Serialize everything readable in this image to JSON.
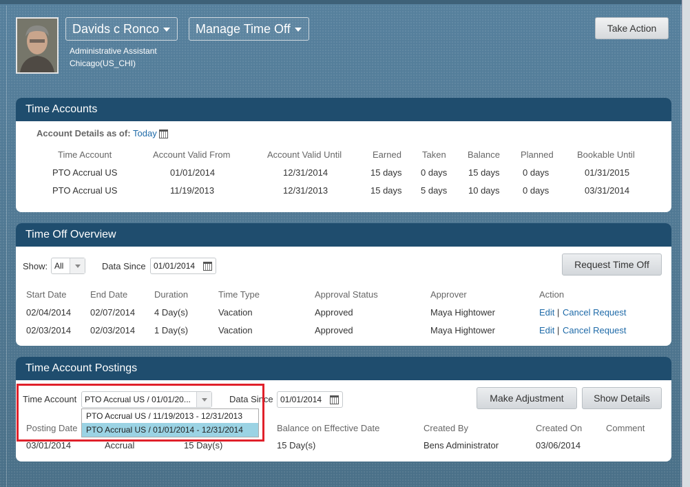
{
  "header": {
    "employee_name": "Davids c Ronco",
    "menu_label": "Manage Time Off",
    "job_title": "Administrative Assistant",
    "location": "Chicago(US_CHI)",
    "take_action": "Take Action"
  },
  "time_accounts": {
    "title": "Time Accounts",
    "details_label": "Account Details as of:",
    "details_value": "Today",
    "columns": [
      "Time Account",
      "Account Valid From",
      "Account Valid Until",
      "Earned",
      "Taken",
      "Balance",
      "Planned",
      "Bookable Until"
    ],
    "rows": [
      [
        "PTO Accrual US",
        "01/01/2014",
        "12/31/2014",
        "15 days",
        "0 days",
        "15 days",
        "0 days",
        "01/31/2015"
      ],
      [
        "PTO Accrual US",
        "11/19/2013",
        "12/31/2013",
        "15 days",
        "5 days",
        "10 days",
        "0 days",
        "03/31/2014"
      ]
    ]
  },
  "time_off_overview": {
    "title": "Time Off Overview",
    "show_label": "Show:",
    "show_value": "All",
    "data_since_label": "Data Since",
    "data_since_value": "01/01/2014",
    "request_button": "Request Time Off",
    "columns": [
      "Start Date",
      "End Date",
      "Duration",
      "Time Type",
      "Approval Status",
      "Approver",
      "Action"
    ],
    "rows": [
      {
        "start": "02/04/2014",
        "end": "02/07/2014",
        "duration": "4 Day(s)",
        "type": "Vacation",
        "status": "Approved",
        "approver": "Maya Hightower",
        "edit": "Edit",
        "sep": "|",
        "cancel": "Cancel Request"
      },
      {
        "start": "02/03/2014",
        "end": "02/03/2014",
        "duration": "1 Day(s)",
        "type": "Vacation",
        "status": "Approved",
        "approver": "Maya Hightower",
        "edit": "Edit",
        "sep": "|",
        "cancel": "Cancel Request"
      }
    ]
  },
  "postings": {
    "title": "Time Account Postings",
    "account_label": "Time Account",
    "account_value": "PTO Accrual US / 01/01/20...",
    "data_since_label": "Data Since",
    "data_since_value": "01/01/2014",
    "make_adjustment": "Make Adjustment",
    "show_details": "Show Details",
    "options": [
      "PTO Accrual US / 11/19/2013 - 12/31/2013",
      "PTO Accrual US / 01/01/2014 - 12/31/2014"
    ],
    "columns": [
      "Posting Date",
      "Balance on Effective Date",
      "Created By",
      "Created On",
      "Comment"
    ],
    "row": {
      "date": "03/01/2014",
      "type": "Accrual",
      "amount": "15 Day(s)",
      "balance": "15 Day(s)",
      "created_by": "Bens Administrator",
      "created_on": "03/06/2014"
    }
  },
  "colors": {
    "panel_header": "#1f4d6e",
    "link": "#1e6aa8",
    "highlight": "#e0202a",
    "selected_option": "#9bd3e4"
  }
}
